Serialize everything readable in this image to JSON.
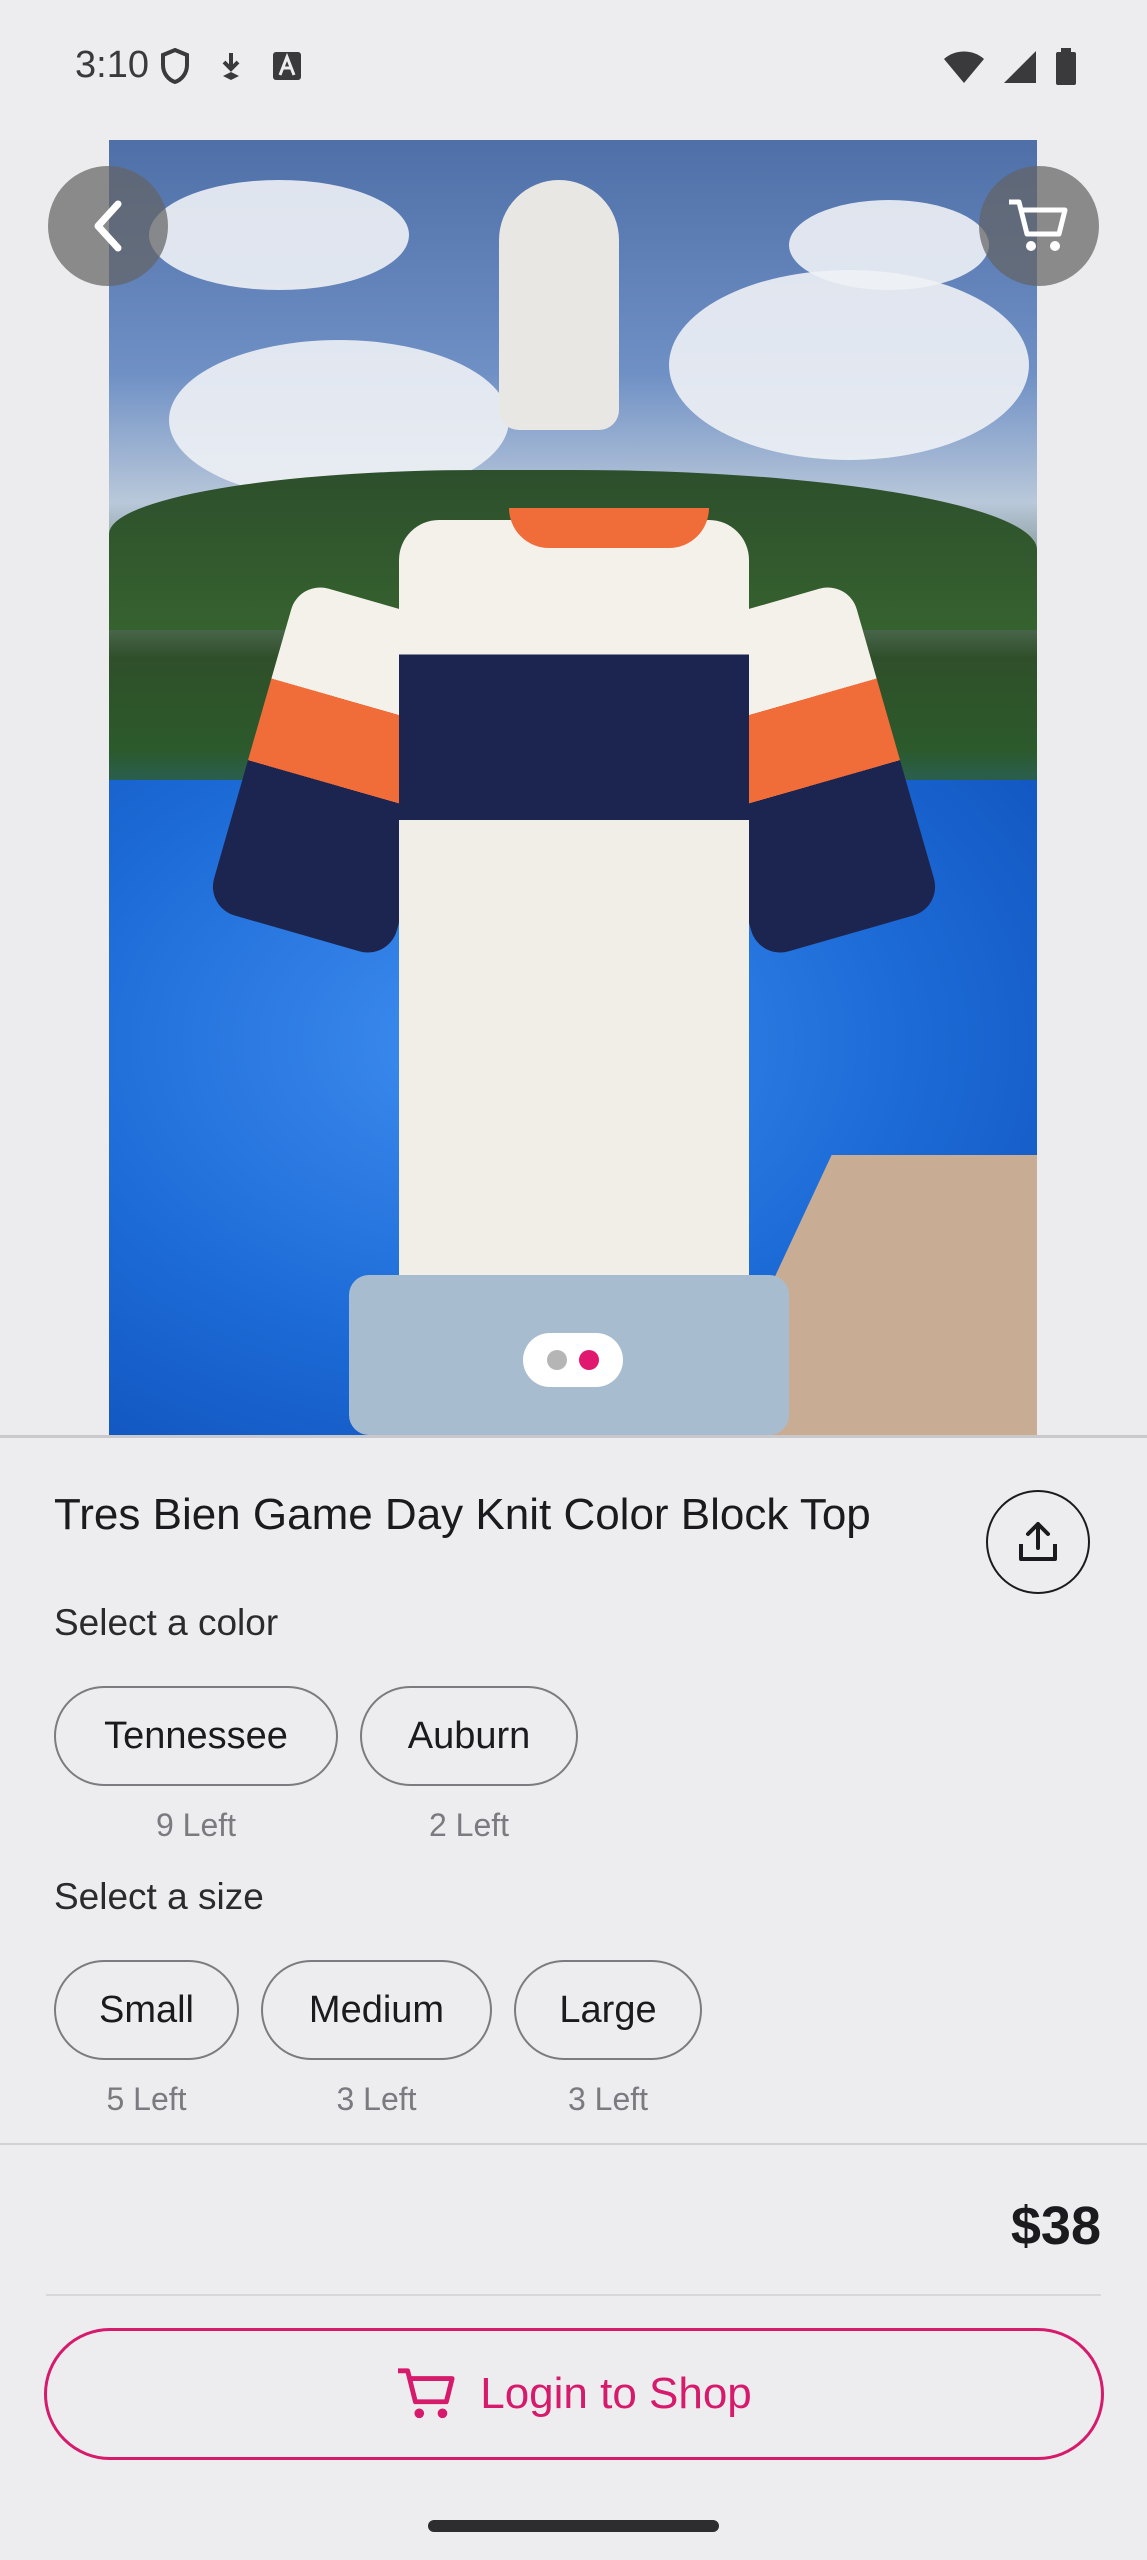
{
  "status_bar": {
    "time": "3:10",
    "left_icons": [
      "shield-icon",
      "download-icon",
      "font-icon"
    ],
    "right_icons": [
      "wifi-icon",
      "signal-icon",
      "battery-icon"
    ]
  },
  "gallery": {
    "image_description_icon": "product-photo",
    "page_count": 2,
    "active_page": 2,
    "active_color": "#e0196e"
  },
  "product": {
    "title": "Tres Bien Game Day Knit Color Block Top",
    "price": "$38"
  },
  "color_section": {
    "label": "Select a color",
    "options": [
      {
        "label": "Tennessee",
        "count": "9 Left"
      },
      {
        "label": "Auburn",
        "count": "2 Left"
      }
    ]
  },
  "size_section": {
    "label": "Select a size",
    "options": [
      {
        "label": "Small",
        "count": "5 Left"
      },
      {
        "label": "Medium",
        "count": "3 Left"
      },
      {
        "label": "Large",
        "count": "3 Left"
      }
    ]
  },
  "cta": {
    "label": "Login to Shop",
    "icon": "cart-icon",
    "accent": "#d61a6c"
  }
}
